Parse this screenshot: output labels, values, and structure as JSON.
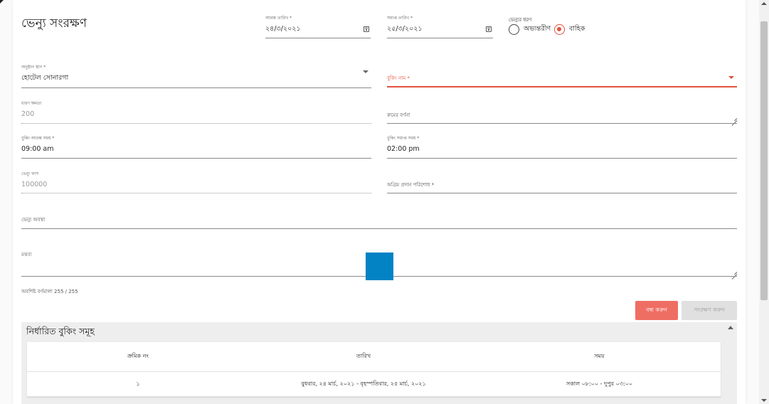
{
  "dialog": {
    "title": "ভেন্যু সংরক্ষণ"
  },
  "form": {
    "start_date": {
      "label": "আরম্ভ তারিখ *",
      "value": "২৪/৩/২০২১"
    },
    "end_date": {
      "label": "সমাপ্ত তারিখ *",
      "value": "২৫/৩/২০২১"
    },
    "venue_type": {
      "label": "ভেন্যুর ধরণ",
      "options": [
        {
          "label": "অভ্যন্তরীণ",
          "selected": false
        },
        {
          "label": "বাহিক",
          "selected": true
        }
      ]
    },
    "venue_place": {
      "label": "অনুষ্ঠান স্থান *",
      "value": "হোটেল সোনারগা"
    },
    "booking_name": {
      "placeholder": "বুকিং নাম *"
    },
    "room_capacity": {
      "label": "ধারণ ক্ষমতা",
      "value": "200"
    },
    "room_description": {
      "placeholder": "রুমের বর্ণনা"
    },
    "booking_start_time": {
      "label": "বুকিং আরম্ভ সময়  *",
      "value": "09:00 am"
    },
    "booking_end_time": {
      "label": "বুকিং সমাপ্ত সময়  *",
      "value": "02:00 pm"
    },
    "venue_fee": {
      "label": "ভেন্যু ফাস",
      "value": "100000"
    },
    "advance_payment": {
      "placeholder": "অগ্রিম প্রদান পরিশোধ  *"
    },
    "venue_status": {
      "placeholder": "ভেন্যু অবস্থা"
    },
    "comment": {
      "label": "মন্তব্য"
    },
    "char_counter": "অবশিষ্ট বর্ণমালা 255 / 255"
  },
  "actions": {
    "close_label": "বন্ধ করুন",
    "save_label": "সংরক্ষণ করুন"
  },
  "bookings_panel": {
    "title": "নির্ধারিত বুকিং সমূহ",
    "columns": [
      "ক্রমিক নং",
      "তারিখ",
      "সময়"
    ],
    "rows": [
      [
        "১",
        "বুধবার, ২৪ মার্চ, ২০২১ - বৃহস্পতিবার, ২৫ মার্চ, ২০২১",
        "সকাল ০৮:০০ - দুপুর ০৩:০০"
      ]
    ]
  },
  "colors": {
    "accent": "#e0513f",
    "close_button": "#ef6e63",
    "drag_handle": "#0382c4"
  }
}
